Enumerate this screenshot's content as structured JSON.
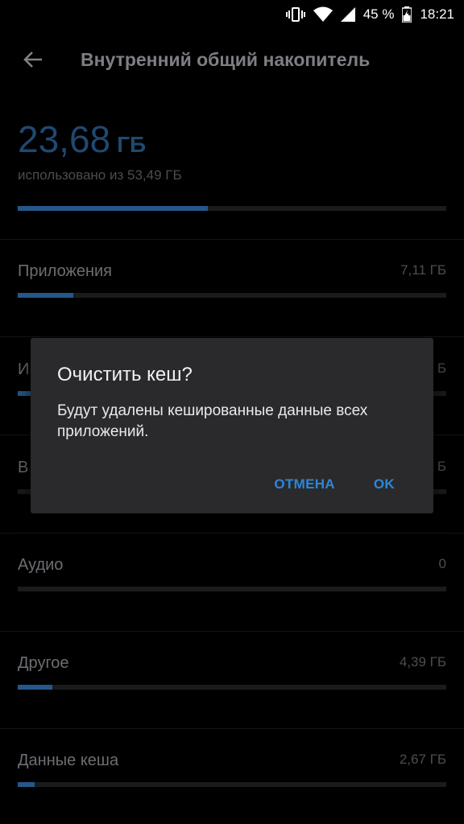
{
  "status": {
    "battery_percent": "45 %",
    "time": "18:21"
  },
  "toolbar": {
    "title": "Внутренний общий накопитель"
  },
  "summary": {
    "used_value": "23,68",
    "used_unit": "ГБ",
    "used_of_text": "использовано из 53,49 ГБ",
    "used_fraction": 0.443
  },
  "categories": [
    {
      "label": "Приложения",
      "value": "7,11 ГБ",
      "fraction": 0.13
    },
    {
      "label": "И",
      "value": "Б",
      "fraction": 0.03
    },
    {
      "label": "В",
      "value": "Б",
      "fraction": 0.0
    },
    {
      "label": "Аудио",
      "value": "0",
      "fraction": 0.0
    },
    {
      "label": "Другое",
      "value": "4,39 ГБ",
      "fraction": 0.08
    },
    {
      "label": "Данные кеша",
      "value": "2,67 ГБ",
      "fraction": 0.04
    }
  ],
  "dialog": {
    "title": "Очистить кеш?",
    "body": "Будут удалены кешированные данные всех приложений.",
    "cancel_label": "ОТМЕНА",
    "ok_label": "OK"
  },
  "colors": {
    "accent": "#2e86d8",
    "bar_fill": "#25588a",
    "dialog_bg": "#2a2a2c"
  }
}
